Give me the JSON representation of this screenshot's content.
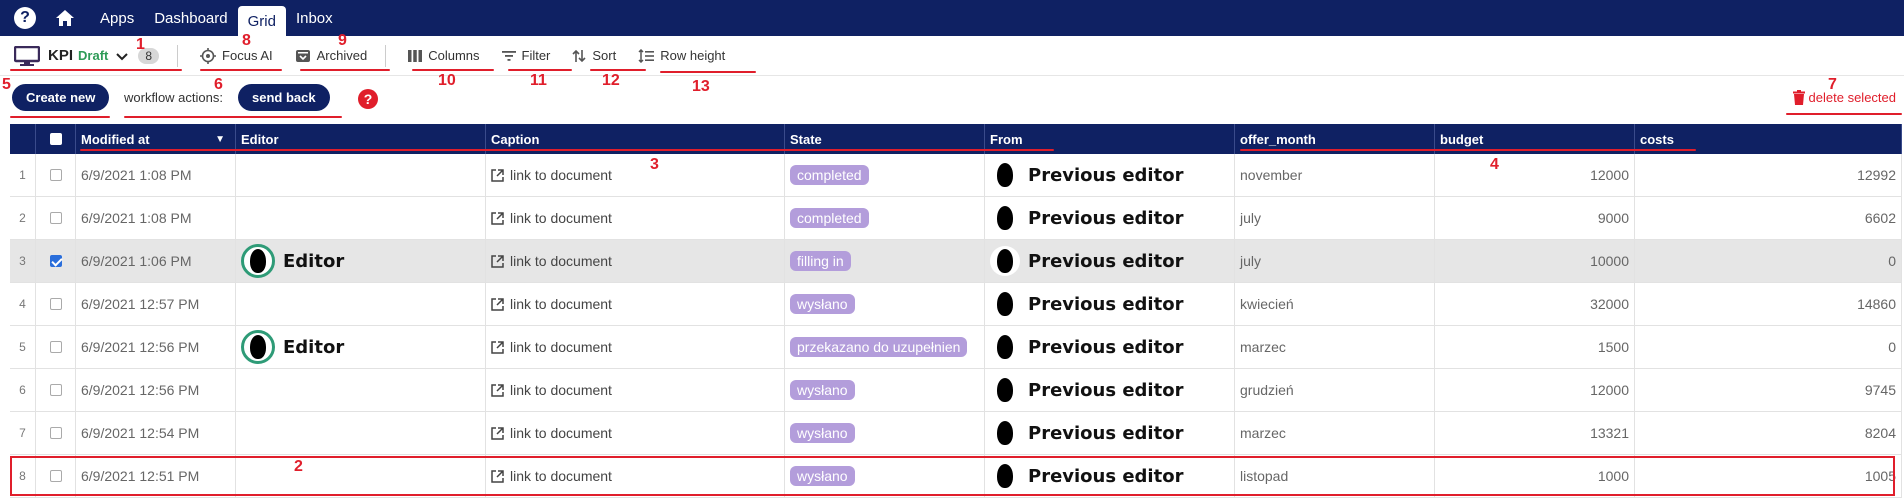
{
  "nav": {
    "help_glyph": "?",
    "links": [
      "Apps",
      "Dashboard",
      "Grid",
      "Inbox"
    ],
    "active": "Grid"
  },
  "toolbar": {
    "kpi_name": "KPI",
    "kpi_status": "Draft",
    "count": "8",
    "focus_ai": "Focus AI",
    "archived": "Archived",
    "columns": "Columns",
    "filter": "Filter",
    "sort": "Sort",
    "row_height": "Row height"
  },
  "actions": {
    "create_new": "Create new",
    "workflow_label": "workflow actions:",
    "send_back": "send back",
    "help_glyph": "?",
    "delete_selected": "delete selected"
  },
  "grid": {
    "headers": [
      "Modified at",
      "Editor",
      "Caption",
      "State",
      "From",
      "offer_month",
      "budget",
      "costs"
    ],
    "rows": [
      {
        "idx": "1",
        "checked": false,
        "modified": "6/9/2021 1:08 PM",
        "editor": "",
        "caption": "link to document",
        "state": "completed",
        "from": "Previous editor",
        "offer_month": "november",
        "budget": "12000",
        "costs": "12992"
      },
      {
        "idx": "2",
        "checked": false,
        "modified": "6/9/2021 1:08 PM",
        "editor": "",
        "caption": "link to document",
        "state": "completed",
        "from": "Previous editor",
        "offer_month": "july",
        "budget": "9000",
        "costs": "6602"
      },
      {
        "idx": "3",
        "checked": true,
        "modified": "6/9/2021 1:06 PM",
        "editor": "Editor",
        "caption": "link to document",
        "state": "filling in",
        "from": "Previous editor",
        "offer_month": "july",
        "budget": "10000",
        "costs": "0"
      },
      {
        "idx": "4",
        "checked": false,
        "modified": "6/9/2021 12:57 PM",
        "editor": "",
        "caption": "link to document",
        "state": "wysłano",
        "from": "Previous editor",
        "offer_month": "kwiecień",
        "budget": "32000",
        "costs": "14860"
      },
      {
        "idx": "5",
        "checked": false,
        "modified": "6/9/2021 12:56 PM",
        "editor": "Editor",
        "caption": "link to document",
        "state": "przekazano do uzupełnien",
        "from": "Previous editor",
        "offer_month": "marzec",
        "budget": "1500",
        "costs": "0"
      },
      {
        "idx": "6",
        "checked": false,
        "modified": "6/9/2021 12:56 PM",
        "editor": "",
        "caption": "link to document",
        "state": "wysłano",
        "from": "Previous editor",
        "offer_month": "grudzień",
        "budget": "12000",
        "costs": "9745"
      },
      {
        "idx": "7",
        "checked": false,
        "modified": "6/9/2021 12:54 PM",
        "editor": "",
        "caption": "link to document",
        "state": "wysłano",
        "from": "Previous editor",
        "offer_month": "marzec",
        "budget": "13321",
        "costs": "8204"
      },
      {
        "idx": "8",
        "checked": false,
        "modified": "6/9/2021 12:51 PM",
        "editor": "",
        "caption": "link to document",
        "state": "wysłano",
        "from": "Previous editor",
        "offer_month": "listopad",
        "budget": "1000",
        "costs": "1005"
      }
    ]
  },
  "annotations": [
    "1",
    "2",
    "3",
    "4",
    "5",
    "6",
    "7",
    "8",
    "9",
    "10",
    "11",
    "12",
    "13"
  ],
  "colors": {
    "nav_bg": "#0f2163",
    "accent_red": "#e01e2b",
    "state_pill": "#b39ddb",
    "draft_green": "#2e9b57"
  }
}
